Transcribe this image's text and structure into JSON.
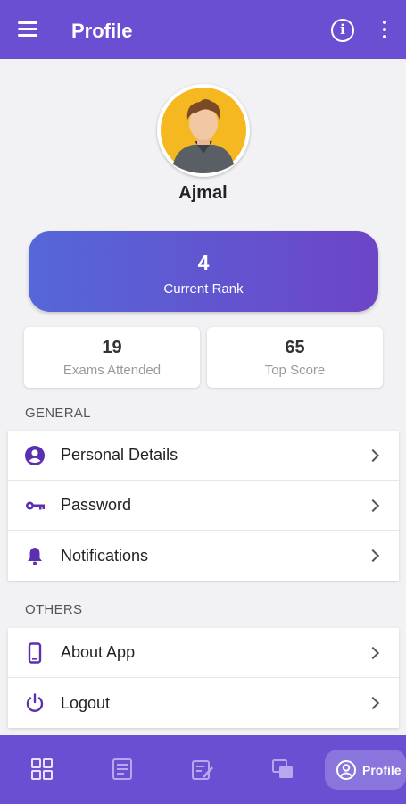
{
  "app_bar": {
    "title": "Profile",
    "menu_icon": "hamburger-menu-icon",
    "info_icon": "info-icon",
    "more_icon": "more-vert-icon"
  },
  "profile": {
    "name": "Ajmal"
  },
  "rank_card": {
    "value": "4",
    "label": "Current Rank",
    "gradient": [
      "#5567d9",
      "#6d45c7"
    ]
  },
  "stats": [
    {
      "value": "19",
      "label": "Exams Attended"
    },
    {
      "value": "65",
      "label": "Top Score"
    }
  ],
  "sections": {
    "general": {
      "title": "GENERAL",
      "items": [
        {
          "label": "Personal Details",
          "icon": "account-circle-icon"
        },
        {
          "label": "Password",
          "icon": "key-icon"
        },
        {
          "label": "Notifications",
          "icon": "bell-icon"
        }
      ]
    },
    "others": {
      "title": "OTHERS",
      "items": [
        {
          "label": "About App",
          "icon": "smartphone-icon"
        },
        {
          "label": "Logout",
          "icon": "power-icon"
        }
      ]
    }
  },
  "bottom_nav": {
    "items": [
      {
        "icon": "dashboard-icon"
      },
      {
        "icon": "exam-list-icon"
      },
      {
        "icon": "edit-exam-icon"
      },
      {
        "icon": "results-icon"
      }
    ],
    "active": {
      "icon": "profile-icon",
      "label": "Profile"
    }
  },
  "colors": {
    "primary": "#6a4fd3",
    "accent_icon": "#5a2fb0",
    "background": "#f2f2f4"
  }
}
